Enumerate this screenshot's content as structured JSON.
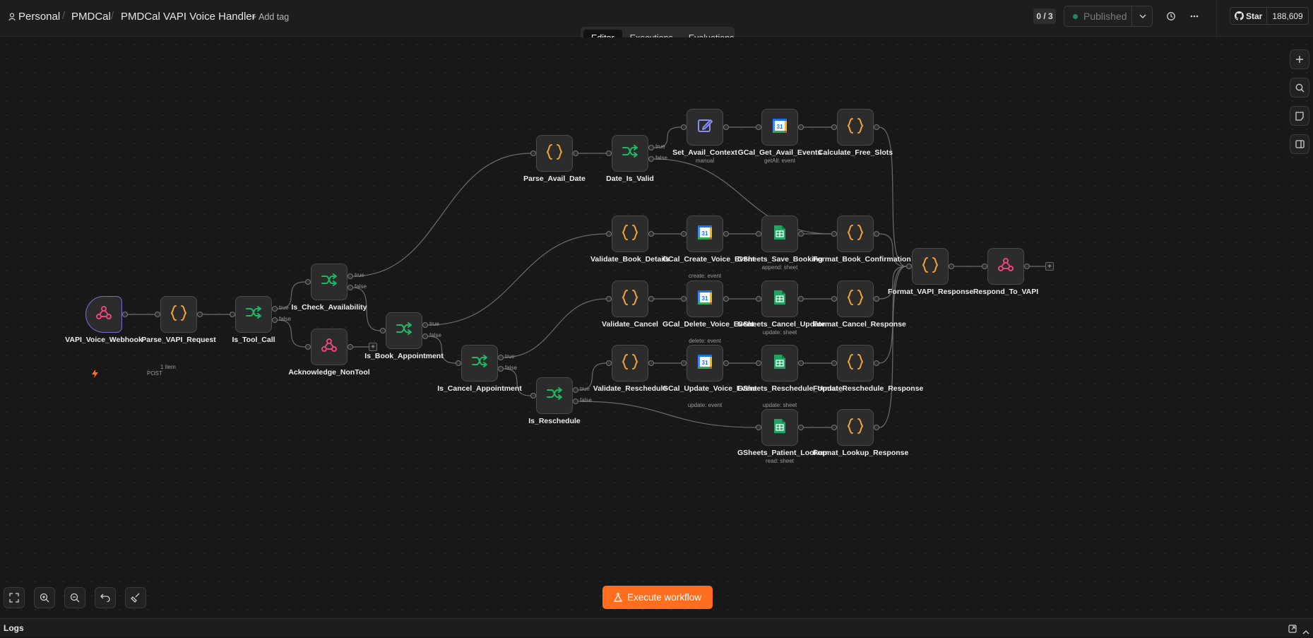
{
  "header": {
    "breadcrumbs": [
      "Personal",
      "PMDCal",
      "PMDCal VAPI Voice Handler"
    ],
    "add_tag": "+ Add tag",
    "counter": "0 / 3",
    "publish_label": "Published",
    "github": {
      "star_label": "Star",
      "count": "188,609"
    }
  },
  "tabs": [
    {
      "label": "Editor",
      "active": true
    },
    {
      "label": "Executions",
      "active": false
    },
    {
      "label": "Evaluations",
      "active": false
    }
  ],
  "nodes": [
    {
      "id": "n1",
      "label": "VAPI_Voice_Webhook",
      "icon": "webhook-icon",
      "kind": "trigger"
    },
    {
      "id": "n2",
      "label": "Parse_VAPI_Request",
      "icon": "code-icon"
    },
    {
      "id": "n3",
      "label": "Is_Tool_Call",
      "icon": "if-icon"
    },
    {
      "id": "n4",
      "label": "Is_Check_Availability",
      "icon": "if-icon"
    },
    {
      "id": "n5",
      "label": "Acknowledge_NonTool",
      "icon": "webhook-icon"
    },
    {
      "id": "n6",
      "label": "Is_Book_Appointment",
      "icon": "if-icon"
    },
    {
      "id": "n7",
      "label": "Is_Cancel_Appointment",
      "icon": "if-icon"
    },
    {
      "id": "n8",
      "label": "Is_Reschedule",
      "icon": "if-icon"
    },
    {
      "id": "n9",
      "label": "Parse_Avail_Date",
      "icon": "code-icon"
    },
    {
      "id": "n10",
      "label": "Date_Is_Valid",
      "icon": "if-icon"
    },
    {
      "id": "n11",
      "label": "Set_Avail_Context",
      "sub": "manual",
      "icon": "edit-icon"
    },
    {
      "id": "n12",
      "label": "GCal_Get_Avail_Events",
      "sub": "getAll: event",
      "icon": "google-calendar-icon"
    },
    {
      "id": "n13",
      "label": "Calculate_Free_Slots",
      "icon": "code-icon"
    },
    {
      "id": "n14",
      "label": "Validate_Book_Details",
      "icon": "code-icon"
    },
    {
      "id": "n15",
      "label": "GCal_Create_Voice_Event",
      "sub": "create: event",
      "icon": "google-calendar-icon"
    },
    {
      "id": "n16",
      "label": "GSheets_Save_Booking",
      "sub": "append: sheet",
      "icon": "google-sheets-icon"
    },
    {
      "id": "n17",
      "label": "Format_Book_Confirmation",
      "icon": "code-icon"
    },
    {
      "id": "n18",
      "label": "Validate_Cancel",
      "icon": "code-icon"
    },
    {
      "id": "n19",
      "label": "GCal_Delete_Voice_Event",
      "sub": "delete: event",
      "icon": "google-calendar-icon"
    },
    {
      "id": "n20",
      "label": "GSheets_Cancel_Update",
      "sub": "update: sheet",
      "icon": "google-sheets-icon"
    },
    {
      "id": "n21",
      "label": "Format_Cancel_Response",
      "icon": "code-icon"
    },
    {
      "id": "n22",
      "label": "Validate_Reschedule",
      "icon": "code-icon"
    },
    {
      "id": "n23",
      "label": "GCal_Update_Voice_Event",
      "sub": "update: event",
      "icon": "google-calendar-icon"
    },
    {
      "id": "n24",
      "label": "GSheets_Reschedule_Update",
      "sub": "update: sheet",
      "icon": "google-sheets-icon"
    },
    {
      "id": "n25",
      "label": "Format_Reschedule_Response",
      "icon": "code-icon"
    },
    {
      "id": "n26",
      "label": "GSheets_Patient_Lookup",
      "sub": "read: sheet",
      "icon": "google-sheets-icon"
    },
    {
      "id": "n27",
      "label": "Format_Lookup_Response",
      "icon": "code-icon"
    },
    {
      "id": "n28",
      "label": "Format_VAPI_Response",
      "icon": "code-icon"
    },
    {
      "id": "n29",
      "label": "Respond_To_VAPI",
      "icon": "webhook-icon"
    }
  ],
  "edge_labels": {
    "items": "1 item",
    "method": "POST"
  },
  "branch_labels": {
    "true": "true",
    "false": "false"
  },
  "execute_label": "Execute workflow",
  "logs_label": "Logs",
  "colors": {
    "accent": "#ff6d1f",
    "if": "#1fb865",
    "code": "#f0a43a",
    "webhook": "#e8467c",
    "trigger_border": "#7b6bd8"
  }
}
